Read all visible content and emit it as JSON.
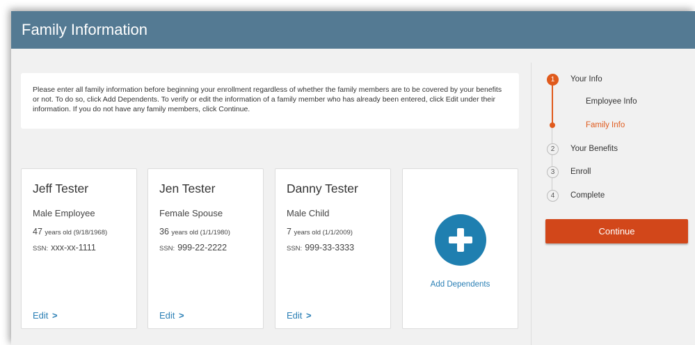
{
  "header": {
    "title": "Family Information"
  },
  "intro": {
    "text": "Please enter all family information before beginning your enrollment regardless of whether the family members are to be covered by your benefits or not. To do so, click Add Dependents. To verify or edit the information of a family member who has already been entered, click Edit under their information. If you do not have any family members, click Continue."
  },
  "members": [
    {
      "name": "Jeff Tester",
      "relation": "Male Employee",
      "age": "47",
      "age_suffix": "years old (9/18/1968)",
      "ssn_label": "SSN:",
      "ssn": "xxx-xx-1111",
      "edit_label": "Edit",
      "edit_chevron": ">"
    },
    {
      "name": "Jen Tester",
      "relation": "Female Spouse",
      "age": "36",
      "age_suffix": "years old (1/1/1980)",
      "ssn_label": "SSN:",
      "ssn": "999-22-2222",
      "edit_label": "Edit",
      "edit_chevron": ">"
    },
    {
      "name": "Danny Tester",
      "relation": "Male Child",
      "age": "7",
      "age_suffix": "years old (1/1/2009)",
      "ssn_label": "SSN:",
      "ssn": "999-33-3333",
      "edit_label": "Edit",
      "edit_chevron": ">"
    }
  ],
  "add_dependents": {
    "label": "Add Dependents",
    "icon": "plus-circle-icon"
  },
  "steps": [
    {
      "number": "1",
      "label": "Your Info"
    },
    {
      "label": "Employee Info"
    },
    {
      "label": "Family Info"
    },
    {
      "number": "2",
      "label": "Your Benefits"
    },
    {
      "number": "3",
      "label": "Enroll"
    },
    {
      "number": "4",
      "label": "Complete"
    }
  ],
  "continue_label": "Continue",
  "colors": {
    "header": "#547a93",
    "accent": "#e05a1c",
    "button": "#d2471a",
    "link": "#2a7fb5"
  }
}
